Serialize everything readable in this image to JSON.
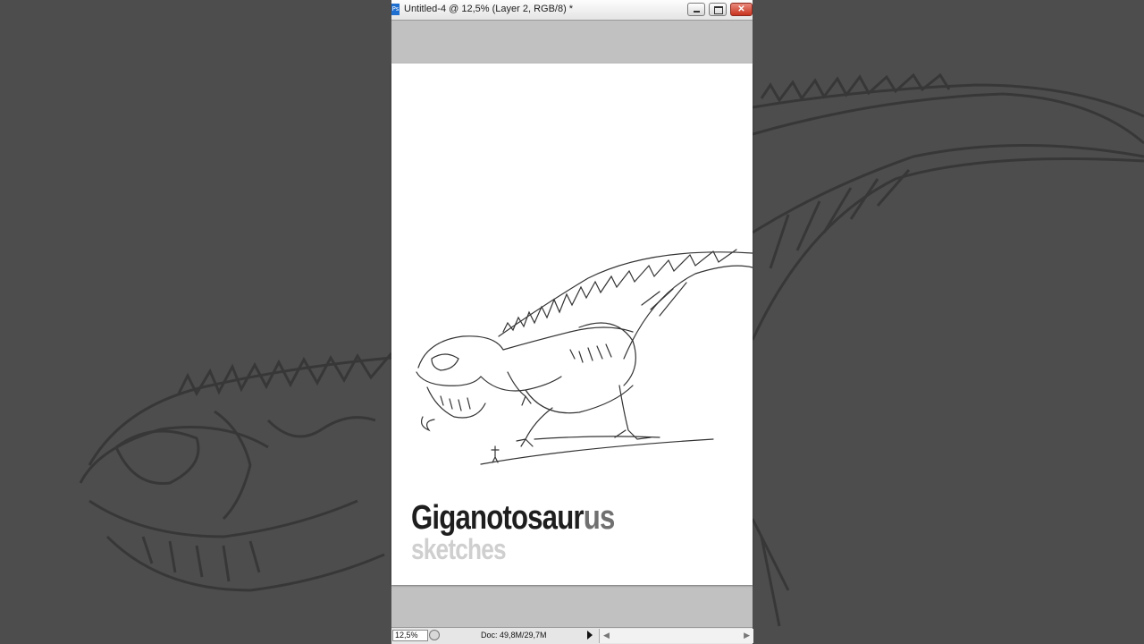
{
  "window": {
    "app_icon_label": "Ps",
    "title": "Untitled-4 @ 12,5% (Layer 2, RGB/8) *"
  },
  "canvas": {
    "title_dark": "Giganotosaur",
    "title_light": "us",
    "subtitle": "sketches"
  },
  "statusbar": {
    "zoom": "12,5%",
    "doc_info": "Doc: 49,8M/29,7M"
  },
  "colors": {
    "workspace": "#c1c1c1",
    "canvas": "#ffffff",
    "background": "#4d4d4d",
    "close_button": "#c8321e"
  }
}
